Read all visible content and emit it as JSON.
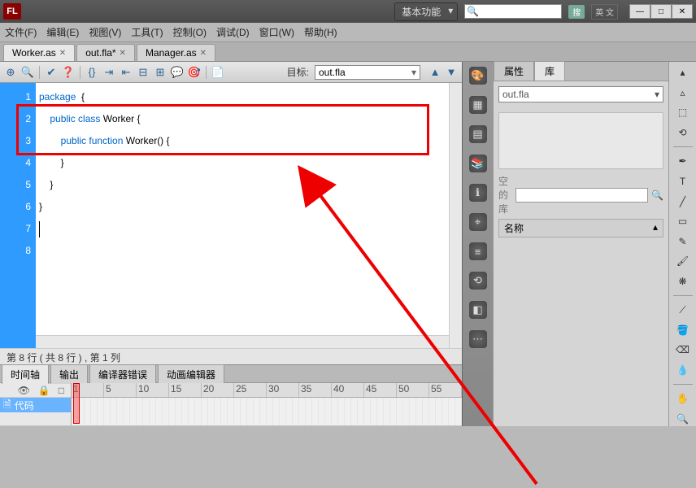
{
  "app": {
    "logo": "FL"
  },
  "title_bar": {
    "workspace": "基本功能",
    "search_placeholder": "",
    "search_icon_text": "搜",
    "lang": "英 文"
  },
  "menu": [
    "文件(F)",
    "编辑(E)",
    "视图(V)",
    "工具(T)",
    "控制(O)",
    "调试(D)",
    "窗口(W)",
    "帮助(H)"
  ],
  "doc_tabs": [
    {
      "label": "Worker.as",
      "active": true
    },
    {
      "label": "out.fla*",
      "active": false
    },
    {
      "label": "Manager.as",
      "active": false
    }
  ],
  "editor_toolbar": {
    "target_label": "目标:",
    "target_value": "out.fla"
  },
  "code": {
    "lines": [
      {
        "n": 1,
        "tokens": [
          [
            "kw",
            "package"
          ],
          [
            "",
            "  {"
          ]
        ]
      },
      {
        "n": 2,
        "tokens": [
          [
            "",
            "    "
          ],
          [
            "kw",
            "public"
          ],
          [
            "",
            " "
          ],
          [
            "kw",
            "class"
          ],
          [
            "",
            " Worker {"
          ]
        ]
      },
      {
        "n": 3,
        "tokens": [
          [
            "",
            "        "
          ],
          [
            "kw",
            "public"
          ],
          [
            "",
            " "
          ],
          [
            "kw",
            "function"
          ],
          [
            "",
            " Worker() {"
          ]
        ]
      },
      {
        "n": 4,
        "tokens": [
          [
            "",
            ""
          ]
        ]
      },
      {
        "n": 5,
        "tokens": [
          [
            "",
            "        }"
          ]
        ]
      },
      {
        "n": 6,
        "tokens": [
          [
            "",
            "    }"
          ]
        ]
      },
      {
        "n": 7,
        "tokens": [
          [
            "",
            "}"
          ]
        ]
      },
      {
        "n": 8,
        "tokens": [
          [
            "",
            ""
          ]
        ]
      }
    ]
  },
  "status": "第 8 行 ( 共 8 行 ) , 第 1 列",
  "bottom_tabs": [
    "时间轴",
    "输出",
    "编译器错误",
    "动画编辑器"
  ],
  "timeline": {
    "ruler": [
      "1",
      "5",
      "10",
      "15",
      "20",
      "25",
      "30",
      "35",
      "40",
      "45",
      "50",
      "55"
    ],
    "layer_name": "代码",
    "layer_icons": [
      "👁",
      "🔒",
      "□"
    ]
  },
  "right_panel": {
    "tabs": [
      "属性",
      "库"
    ],
    "doc_dd": "out.fla",
    "empty_label": "空的库",
    "name_header": "名称"
  },
  "vert_strip_icons": [
    "palette",
    "grid",
    "swatch",
    "lib",
    "info",
    "target",
    "align",
    "transform",
    "color",
    "misc"
  ],
  "tools": [
    "select",
    "subselect",
    "free-transform",
    "lasso",
    "pen",
    "text",
    "line",
    "rectangle",
    "pencil",
    "brush",
    "deco",
    "bone",
    "paint-bucket",
    "erase",
    "eyedropper",
    "hand",
    "zoom"
  ],
  "colors": {
    "stroke": "#000000",
    "fill": "#ffffff"
  }
}
